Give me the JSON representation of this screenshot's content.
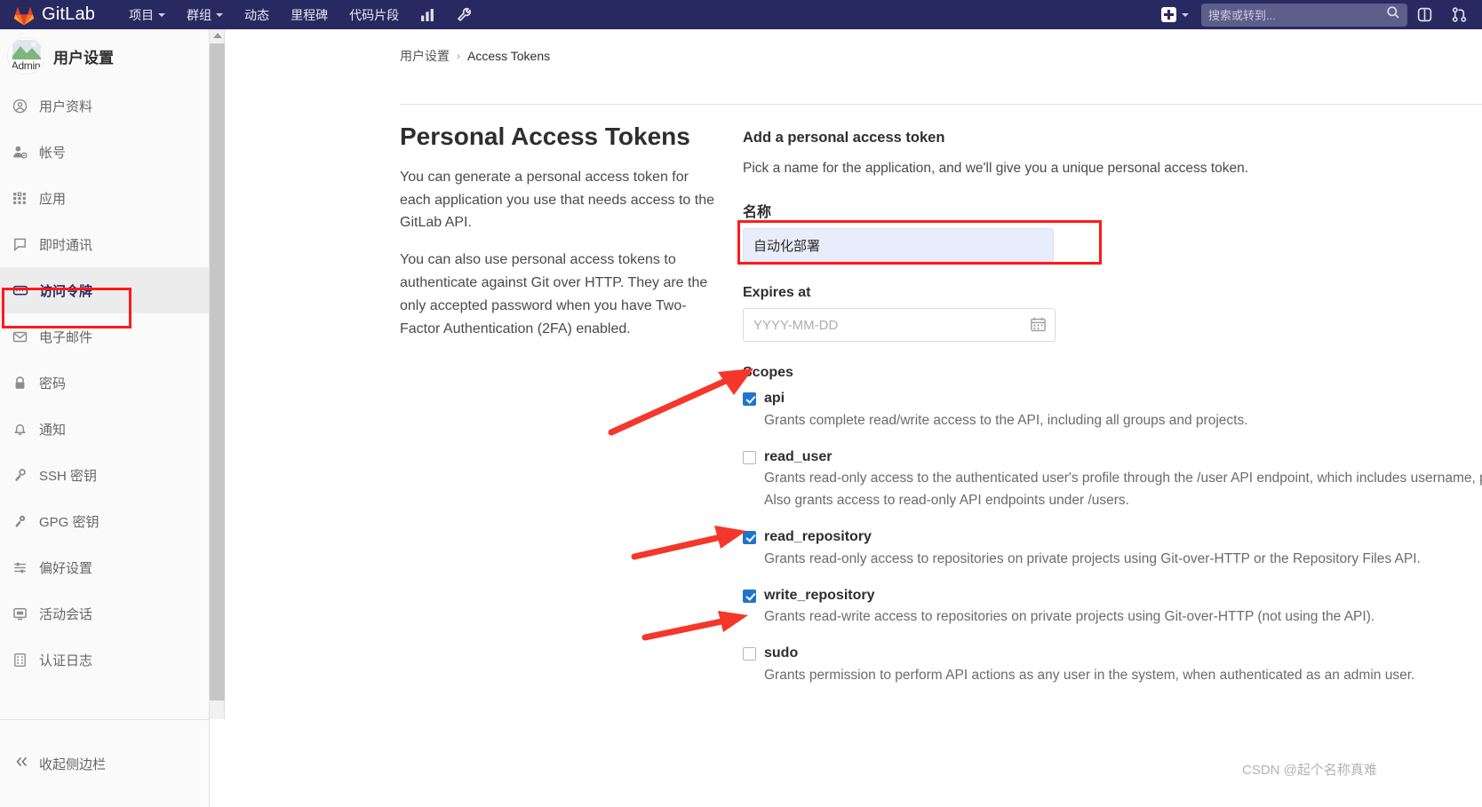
{
  "topnav": {
    "brand": "GitLab",
    "menu": [
      {
        "label": "项目",
        "caret": true
      },
      {
        "label": "群组",
        "caret": true
      },
      {
        "label": "动态",
        "caret": false
      },
      {
        "label": "里程碑",
        "caret": false
      },
      {
        "label": "代码片段",
        "caret": false
      }
    ],
    "icons": [
      "chart-icon",
      "wrench-icon"
    ],
    "create_label": "",
    "search_placeholder": "搜索或转到...",
    "right_icons": [
      "issues-icon",
      "merge-requests-icon"
    ]
  },
  "sidebar": {
    "avatar_label": "Admin",
    "title": "用户设置",
    "items": [
      {
        "label": "用户资料",
        "icon": "profile-icon",
        "active": false
      },
      {
        "label": "帐号",
        "icon": "account-icon",
        "active": false
      },
      {
        "label": "应用",
        "icon": "applications-icon",
        "active": false
      },
      {
        "label": "即时通讯",
        "icon": "chat-icon",
        "active": false
      },
      {
        "label": "访问令牌",
        "icon": "token-icon",
        "active": true
      },
      {
        "label": "电子邮件",
        "icon": "mail-icon",
        "active": false
      },
      {
        "label": "密码",
        "icon": "lock-icon",
        "active": false
      },
      {
        "label": "通知",
        "icon": "bell-icon",
        "active": false
      },
      {
        "label": "SSH 密钥",
        "icon": "key-icon",
        "active": false
      },
      {
        "label": "GPG 密钥",
        "icon": "key-icon",
        "active": false
      },
      {
        "label": "偏好设置",
        "icon": "preferences-icon",
        "active": false
      },
      {
        "label": "活动会话",
        "icon": "monitor-icon",
        "active": false
      },
      {
        "label": "认证日志",
        "icon": "log-icon",
        "active": false
      }
    ],
    "collapse_label": "收起侧边栏"
  },
  "breadcrumb": {
    "root": "用户设置",
    "separator": "›",
    "current": "Access Tokens"
  },
  "page": {
    "heading": "Personal Access Tokens",
    "paragraph1": "You can generate a personal access token for each application you use that needs access to the GitLab API.",
    "paragraph2": "You can also use personal access tokens to authenticate against Git over HTTP. They are the only accepted password when you have Two-Factor Authentication (2FA) enabled."
  },
  "form": {
    "title": "Add a personal access token",
    "subtitle": "Pick a name for the application, and we'll give you a unique personal access token.",
    "name_label": "名称",
    "name_value": "自动化部署",
    "expires_label": "Expires at",
    "expires_value": "",
    "expires_placeholder": "YYYY-MM-DD",
    "scopes_label": "Scopes",
    "scopes": [
      {
        "name": "api",
        "checked": true,
        "description": "Grants complete read/write access to the API, including all groups and projects."
      },
      {
        "name": "read_user",
        "checked": false,
        "description": "Grants read-only access to the authenticated user's profile through the /user API endpoint, which includes username, public email, and full name. Also grants access to read-only API endpoints under /users."
      },
      {
        "name": "read_repository",
        "checked": true,
        "description": "Grants read-only access to repositories on private projects using Git-over-HTTP or the Repository Files API."
      },
      {
        "name": "write_repository",
        "checked": true,
        "description": "Grants read-write access to repositories on private projects using Git-over-HTTP (not using the API)."
      },
      {
        "name": "sudo",
        "checked": false,
        "description": "Grants permission to perform API actions as any user in the system, when authenticated as an admin user."
      }
    ]
  },
  "annotations": {
    "highlight_color": "#ff1a1a",
    "arrow_color": "#f4372a",
    "watermark": "CSDN @起个名称真难"
  },
  "colors": {
    "navbar": "#292961",
    "accent": "#1f75cb",
    "sidebar_bg": "#fafafa",
    "active_bg": "#ececec"
  }
}
